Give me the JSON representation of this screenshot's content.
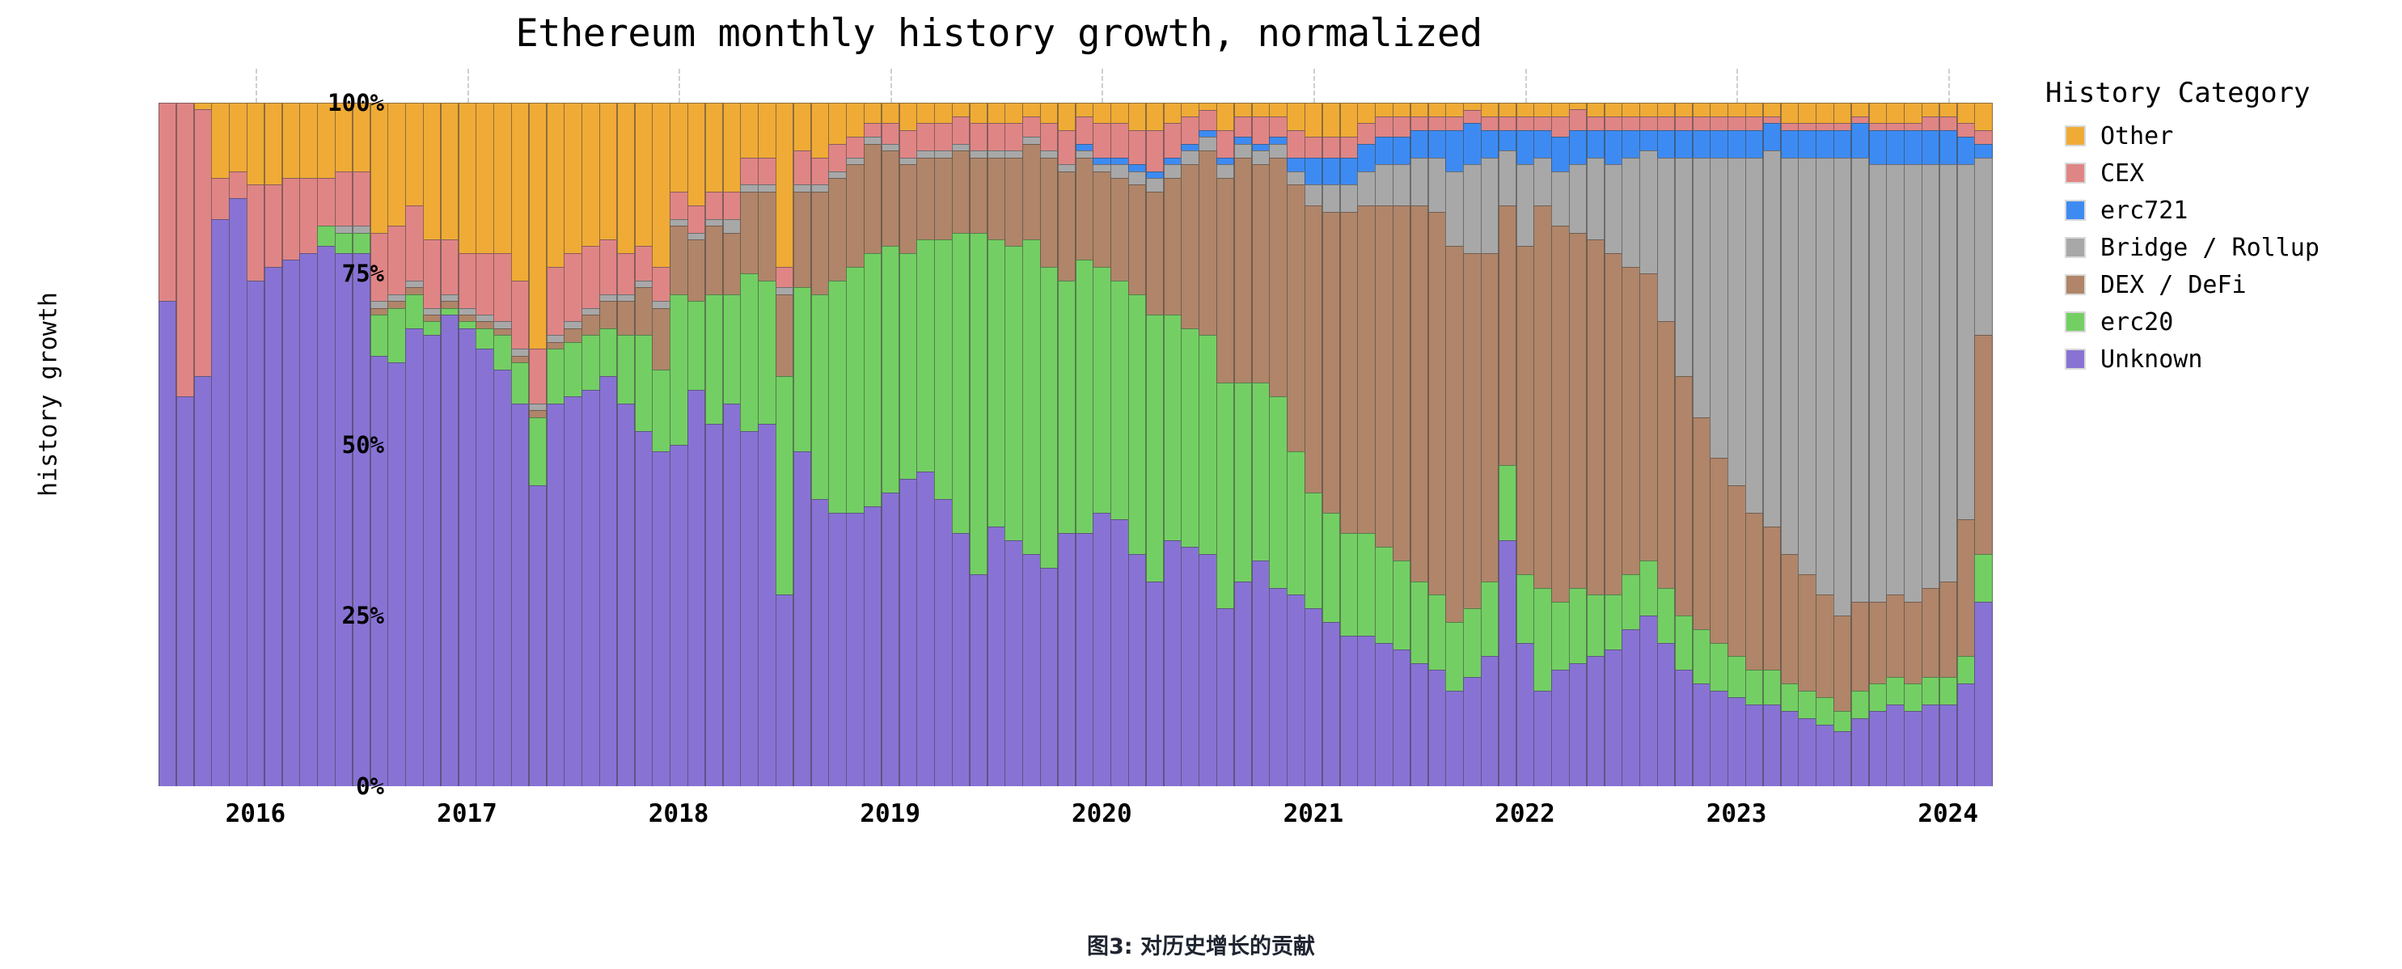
{
  "title": "Ethereum monthly history growth, normalized",
  "caption": "图3: 对历史增长的贡献",
  "axes": {
    "ylabel": "history growth",
    "yticks": [
      "0%",
      "25%",
      "50%",
      "75%",
      "100%"
    ],
    "xticks": [
      "2016",
      "2017",
      "2018",
      "2019",
      "2020",
      "2021",
      "2022",
      "2023",
      "2024"
    ]
  },
  "legend": {
    "title": "History Category",
    "items": [
      {
        "label": "Other",
        "color": "#efab36"
      },
      {
        "label": "CEX",
        "color": "#e08585"
      },
      {
        "label": "erc721",
        "color": "#3d8bf2"
      },
      {
        "label": "Bridge / Rollup",
        "color": "#a8a8a8"
      },
      {
        "label": "DEX / DeFi",
        "color": "#b08569"
      },
      {
        "label": "erc20",
        "color": "#73cf63"
      },
      {
        "label": "Unknown",
        "color": "#8873d4"
      }
    ]
  },
  "chart_data": {
    "type": "bar",
    "subtype": "stacked-percent",
    "title": "Ethereum monthly history growth, normalized",
    "xlabel": "",
    "ylabel": "history growth",
    "ylim": [
      0,
      100
    ],
    "grid": true,
    "legend_position": "right",
    "legend_title": "History Category",
    "stack_order_bottom_to_top": [
      "Unknown",
      "erc20",
      "DEX / DeFi",
      "Bridge / Rollup",
      "erc721",
      "CEX",
      "Other"
    ],
    "colors": {
      "Unknown": "#8873d4",
      "erc20": "#73cf63",
      "DEX / DeFi": "#b08569",
      "Bridge / Rollup": "#a8a8a8",
      "erc721": "#3d8bf2",
      "CEX": "#e08585",
      "Other": "#efab36"
    },
    "x_start": "2015-08",
    "x_end": "2024-04",
    "x_unit": "month",
    "categories": [
      "2015-08",
      "2015-09",
      "2015-10",
      "2015-11",
      "2015-12",
      "2016-01",
      "2016-02",
      "2016-03",
      "2016-04",
      "2016-05",
      "2016-06",
      "2016-07",
      "2016-08",
      "2016-09",
      "2016-10",
      "2016-11",
      "2016-12",
      "2017-01",
      "2017-02",
      "2017-03",
      "2017-04",
      "2017-05",
      "2017-06",
      "2017-07",
      "2017-08",
      "2017-09",
      "2017-10",
      "2017-11",
      "2017-12",
      "2018-01",
      "2018-02",
      "2018-03",
      "2018-04",
      "2018-05",
      "2018-06",
      "2018-07",
      "2018-08",
      "2018-09",
      "2018-10",
      "2018-11",
      "2018-12",
      "2019-01",
      "2019-02",
      "2019-03",
      "2019-04",
      "2019-05",
      "2019-06",
      "2019-07",
      "2019-08",
      "2019-09",
      "2019-10",
      "2019-11",
      "2019-12",
      "2020-01",
      "2020-02",
      "2020-03",
      "2020-04",
      "2020-05",
      "2020-06",
      "2020-07",
      "2020-08",
      "2020-09",
      "2020-10",
      "2020-11",
      "2020-12",
      "2021-01",
      "2021-02",
      "2021-03",
      "2021-04",
      "2021-05",
      "2021-06",
      "2021-07",
      "2021-08",
      "2021-09",
      "2021-10",
      "2021-11",
      "2021-12",
      "2022-01",
      "2022-02",
      "2022-03",
      "2022-04",
      "2022-05",
      "2022-06",
      "2022-07",
      "2022-08",
      "2022-09",
      "2022-10",
      "2022-11",
      "2022-12",
      "2023-01",
      "2023-02",
      "2023-03",
      "2023-04",
      "2023-05",
      "2023-06",
      "2023-07",
      "2023-08",
      "2023-09",
      "2023-10",
      "2023-11",
      "2023-12",
      "2024-01",
      "2024-02",
      "2024-03",
      "2024-04"
    ],
    "series": [
      {
        "name": "Unknown",
        "values": [
          71,
          57,
          60,
          83,
          86,
          74,
          76,
          77,
          78,
          79,
          78,
          78,
          63,
          62,
          67,
          66,
          69,
          67,
          64,
          61,
          56,
          44,
          56,
          57,
          58,
          60,
          56,
          52,
          49,
          50,
          58,
          53,
          56,
          52,
          53,
          28,
          49,
          42,
          40,
          40,
          41,
          43,
          45,
          46,
          42,
          37,
          31,
          38,
          36,
          34,
          32,
          37,
          37,
          40,
          39,
          34,
          30,
          36,
          35,
          34,
          26,
          30,
          33,
          29,
          28,
          26,
          24,
          22,
          22,
          21,
          20,
          18,
          17,
          14,
          16,
          19,
          36,
          21,
          14,
          17,
          18,
          19,
          20,
          23,
          25,
          21,
          17,
          15,
          14,
          13,
          12,
          12,
          11,
          10,
          9,
          8,
          10,
          11,
          12,
          11,
          12,
          12,
          15,
          27
        ]
      },
      {
        "name": "erc20",
        "values": [
          0,
          0,
          0,
          0,
          0,
          0,
          0,
          0,
          0,
          3,
          3,
          3,
          6,
          8,
          5,
          2,
          1,
          1,
          3,
          5,
          6,
          10,
          8,
          8,
          8,
          7,
          10,
          14,
          12,
          22,
          13,
          19,
          16,
          23,
          21,
          32,
          24,
          30,
          34,
          36,
          37,
          36,
          33,
          34,
          38,
          44,
          50,
          42,
          43,
          46,
          44,
          37,
          40,
          36,
          35,
          38,
          39,
          33,
          32,
          32,
          33,
          29,
          26,
          28,
          21,
          17,
          16,
          15,
          15,
          14,
          13,
          12,
          11,
          10,
          10,
          11,
          11,
          10,
          15,
          10,
          11,
          9,
          8,
          8,
          8,
          8,
          8,
          8,
          7,
          6,
          5,
          5,
          4,
          4,
          4,
          3,
          4,
          4,
          4,
          4,
          4,
          4,
          4,
          7
        ]
      },
      {
        "name": "DEX / DeFi",
        "values": [
          0,
          0,
          0,
          0,
          0,
          0,
          0,
          0,
          0,
          0,
          0,
          0,
          1,
          1,
          1,
          1,
          1,
          1,
          1,
          1,
          1,
          1,
          1,
          2,
          3,
          4,
          5,
          7,
          9,
          10,
          9,
          10,
          9,
          12,
          13,
          12,
          14,
          15,
          15,
          15,
          16,
          14,
          13,
          12,
          12,
          12,
          11,
          12,
          13,
          14,
          16,
          16,
          15,
          14,
          15,
          16,
          18,
          20,
          24,
          27,
          30,
          33,
          32,
          35,
          39,
          42,
          44,
          47,
          48,
          50,
          52,
          55,
          56,
          55,
          52,
          48,
          38,
          48,
          56,
          55,
          52,
          52,
          50,
          45,
          42,
          39,
          35,
          31,
          27,
          25,
          23,
          21,
          19,
          17,
          15,
          14,
          13,
          12,
          12,
          12,
          13,
          14,
          20,
          32
        ]
      },
      {
        "name": "Bridge / Rollup",
        "values": [
          0,
          0,
          0,
          0,
          0,
          0,
          0,
          0,
          0,
          0,
          1,
          1,
          1,
          1,
          1,
          1,
          1,
          1,
          1,
          1,
          1,
          1,
          1,
          1,
          1,
          1,
          1,
          1,
          1,
          1,
          1,
          1,
          2,
          1,
          1,
          1,
          1,
          1,
          1,
          1,
          1,
          1,
          1,
          1,
          1,
          1,
          1,
          1,
          1,
          1,
          1,
          1,
          1,
          1,
          2,
          2,
          2,
          2,
          2,
          2,
          2,
          2,
          2,
          2,
          2,
          3,
          4,
          4,
          5,
          6,
          6,
          7,
          8,
          11,
          13,
          14,
          8,
          12,
          7,
          8,
          10,
          12,
          13,
          16,
          18,
          24,
          32,
          38,
          44,
          48,
          52,
          55,
          58,
          61,
          64,
          67,
          65,
          64,
          63,
          64,
          62,
          61,
          52,
          26
        ]
      },
      {
        "name": "erc721",
        "values": [
          0,
          0,
          0,
          0,
          0,
          0,
          0,
          0,
          0,
          0,
          0,
          0,
          0,
          0,
          0,
          0,
          0,
          0,
          0,
          0,
          0,
          0,
          0,
          0,
          0,
          0,
          0,
          0,
          0,
          0,
          0,
          0,
          0,
          0,
          0,
          0,
          0,
          0,
          0,
          0,
          0,
          0,
          0,
          0,
          0,
          0,
          0,
          0,
          0,
          0,
          0,
          0,
          1,
          1,
          1,
          1,
          1,
          1,
          1,
          1,
          1,
          1,
          1,
          1,
          2,
          4,
          4,
          4,
          4,
          4,
          4,
          4,
          4,
          6,
          6,
          4,
          3,
          5,
          4,
          5,
          5,
          4,
          5,
          4,
          3,
          4,
          4,
          4,
          4,
          4,
          4,
          4,
          4,
          4,
          4,
          4,
          5,
          5,
          5,
          5,
          5,
          5,
          4,
          2
        ]
      },
      {
        "name": "CEX",
        "values": [
          29,
          43,
          39,
          6,
          4,
          14,
          12,
          12,
          11,
          7,
          8,
          8,
          10,
          10,
          11,
          10,
          8,
          8,
          9,
          10,
          10,
          8,
          10,
          10,
          9,
          8,
          6,
          5,
          5,
          4,
          4,
          4,
          4,
          4,
          4,
          3,
          5,
          4,
          4,
          3,
          2,
          3,
          4,
          4,
          4,
          4,
          4,
          4,
          4,
          3,
          4,
          5,
          4,
          5,
          5,
          5,
          6,
          5,
          4,
          3,
          4,
          3,
          4,
          3,
          4,
          3,
          3,
          3,
          3,
          3,
          3,
          2,
          2,
          2,
          2,
          2,
          2,
          2,
          2,
          3,
          3,
          2,
          2,
          2,
          2,
          2,
          2,
          2,
          2,
          2,
          2,
          1,
          1,
          1,
          1,
          1,
          1,
          1,
          1,
          1,
          2,
          2,
          2,
          2
        ]
      },
      {
        "name": "Other",
        "values": [
          0,
          0,
          1,
          11,
          10,
          12,
          12,
          11,
          11,
          11,
          10,
          10,
          19,
          18,
          15,
          20,
          20,
          22,
          22,
          22,
          26,
          36,
          24,
          22,
          21,
          20,
          22,
          21,
          24,
          13,
          15,
          13,
          13,
          8,
          8,
          24,
          7,
          8,
          6,
          5,
          3,
          3,
          4,
          3,
          3,
          2,
          3,
          3,
          3,
          2,
          3,
          4,
          2,
          3,
          3,
          4,
          4,
          3,
          2,
          1,
          4,
          2,
          2,
          2,
          4,
          5,
          5,
          5,
          3,
          2,
          2,
          2,
          2,
          2,
          1,
          2,
          2,
          2,
          2,
          2,
          1,
          2,
          2,
          2,
          2,
          2,
          2,
          2,
          2,
          2,
          2,
          2,
          3,
          3,
          3,
          3,
          2,
          3,
          3,
          3,
          2,
          2,
          3,
          4
        ]
      }
    ]
  }
}
